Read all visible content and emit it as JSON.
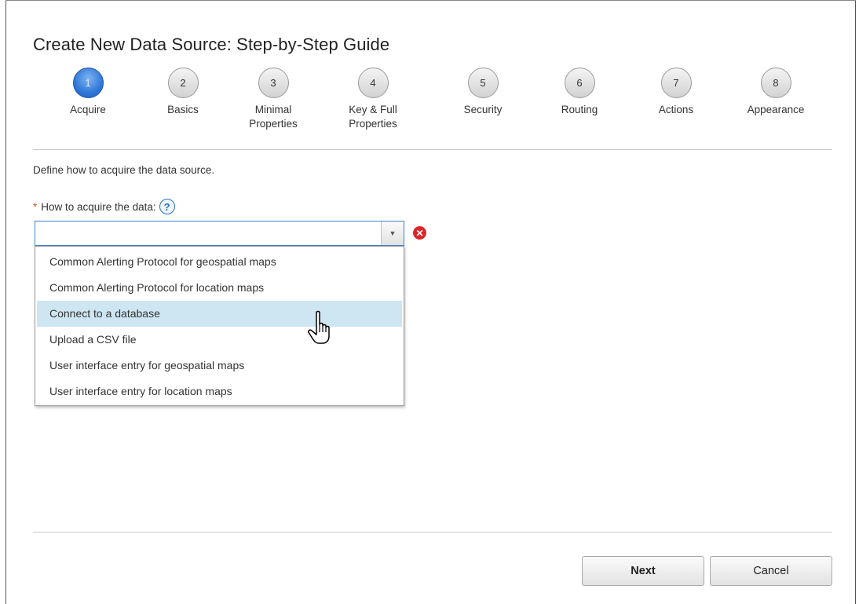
{
  "dialog": {
    "title": "Create New Data Source: Step-by-Step Guide",
    "intro": "Define how to acquire the data source.",
    "field_required_marker": "*",
    "field_label": "How to acquire the data:",
    "help_icon": "?",
    "combo_value": "",
    "error_icon": "✕"
  },
  "steps": [
    {
      "number": "1",
      "label": "Acquire",
      "active": true
    },
    {
      "number": "2",
      "label": "Basics",
      "active": false
    },
    {
      "number": "3",
      "label": "Minimal Properties",
      "active": false
    },
    {
      "number": "4",
      "label": "Key & Full Properties",
      "active": false
    },
    {
      "number": "5",
      "label": "Security",
      "active": false
    },
    {
      "number": "6",
      "label": "Routing",
      "active": false
    },
    {
      "number": "7",
      "label": "Actions",
      "active": false
    },
    {
      "number": "8",
      "label": "Appearance",
      "active": false
    }
  ],
  "dropdown": {
    "options": [
      "Common Alerting Protocol for geospatial maps",
      "Common Alerting Protocol for location maps",
      "Connect to a database",
      "Upload a CSV file",
      "User interface entry for geospatial maps",
      "User interface entry for location maps"
    ],
    "hovered_option": "Connect to a database"
  },
  "buttons": {
    "next": "Next",
    "cancel": "Cancel"
  },
  "colors": {
    "active_step": "#2f78d8",
    "hover_option": "#cde6f2",
    "error": "#e0242b",
    "required": "#d05a1c"
  }
}
